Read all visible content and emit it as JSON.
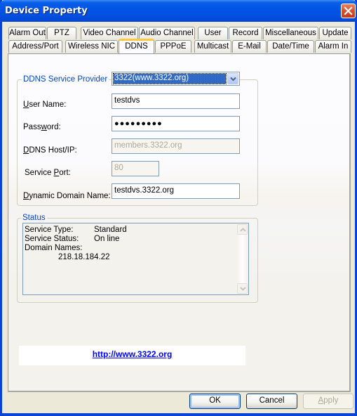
{
  "window": {
    "title": "Device Property"
  },
  "tabs": {
    "row1": [
      {
        "label": "Alarm Out"
      },
      {
        "label": "PTZ"
      },
      {
        "label": "Video Channel"
      },
      {
        "label": "Audio Channel"
      },
      {
        "label": "User"
      },
      {
        "label": "Record"
      },
      {
        "label": "Miscellaneous"
      },
      {
        "label": "Update"
      }
    ],
    "row2": [
      {
        "label": "Address/Port"
      },
      {
        "label": "Wireless NIC"
      },
      {
        "label": "DDNS",
        "active": true
      },
      {
        "label": "PPPoE"
      },
      {
        "label": "Multicast"
      },
      {
        "label": "E-Mail"
      },
      {
        "label": "Date/Time"
      },
      {
        "label": "Alarm In"
      }
    ]
  },
  "ddns": {
    "group_label": "DDNS Service Provider",
    "provider_selected": "3322(www.3322.org)",
    "fields": {
      "user_name": {
        "label_hotkey": "U",
        "label_rest": "ser Name:",
        "value": "testdvs"
      },
      "password": {
        "label_pre": "Pass",
        "label_hotkey": "w",
        "label_rest": "ord:",
        "value": "●●●●●●●●●"
      },
      "host": {
        "label_hotkey": "D",
        "label_rest": "DNS Host/IP:",
        "value": "members.3322.org",
        "disabled": true
      },
      "port": {
        "label_pre": "Service ",
        "label_hotkey": "P",
        "label_rest": "ort:",
        "value": "80",
        "disabled": true
      },
      "domain": {
        "label_hotkey": "D",
        "label_rest": "ynamic Domain Name:",
        "value": "testdvs.3322.org"
      }
    }
  },
  "status": {
    "group_label": "Status",
    "lines": [
      {
        "key": "Service Type:",
        "value": "Standard"
      },
      {
        "key": "Service Status:",
        "value": "On line"
      },
      {
        "key": "Domain Names:",
        "value": ""
      }
    ],
    "ip": "218.18.184.22"
  },
  "link": {
    "text": "http://www.3322.org"
  },
  "buttons": {
    "ok": "OK",
    "cancel": "Cancel",
    "apply_hotkey": "A",
    "apply_rest": "pply"
  }
}
